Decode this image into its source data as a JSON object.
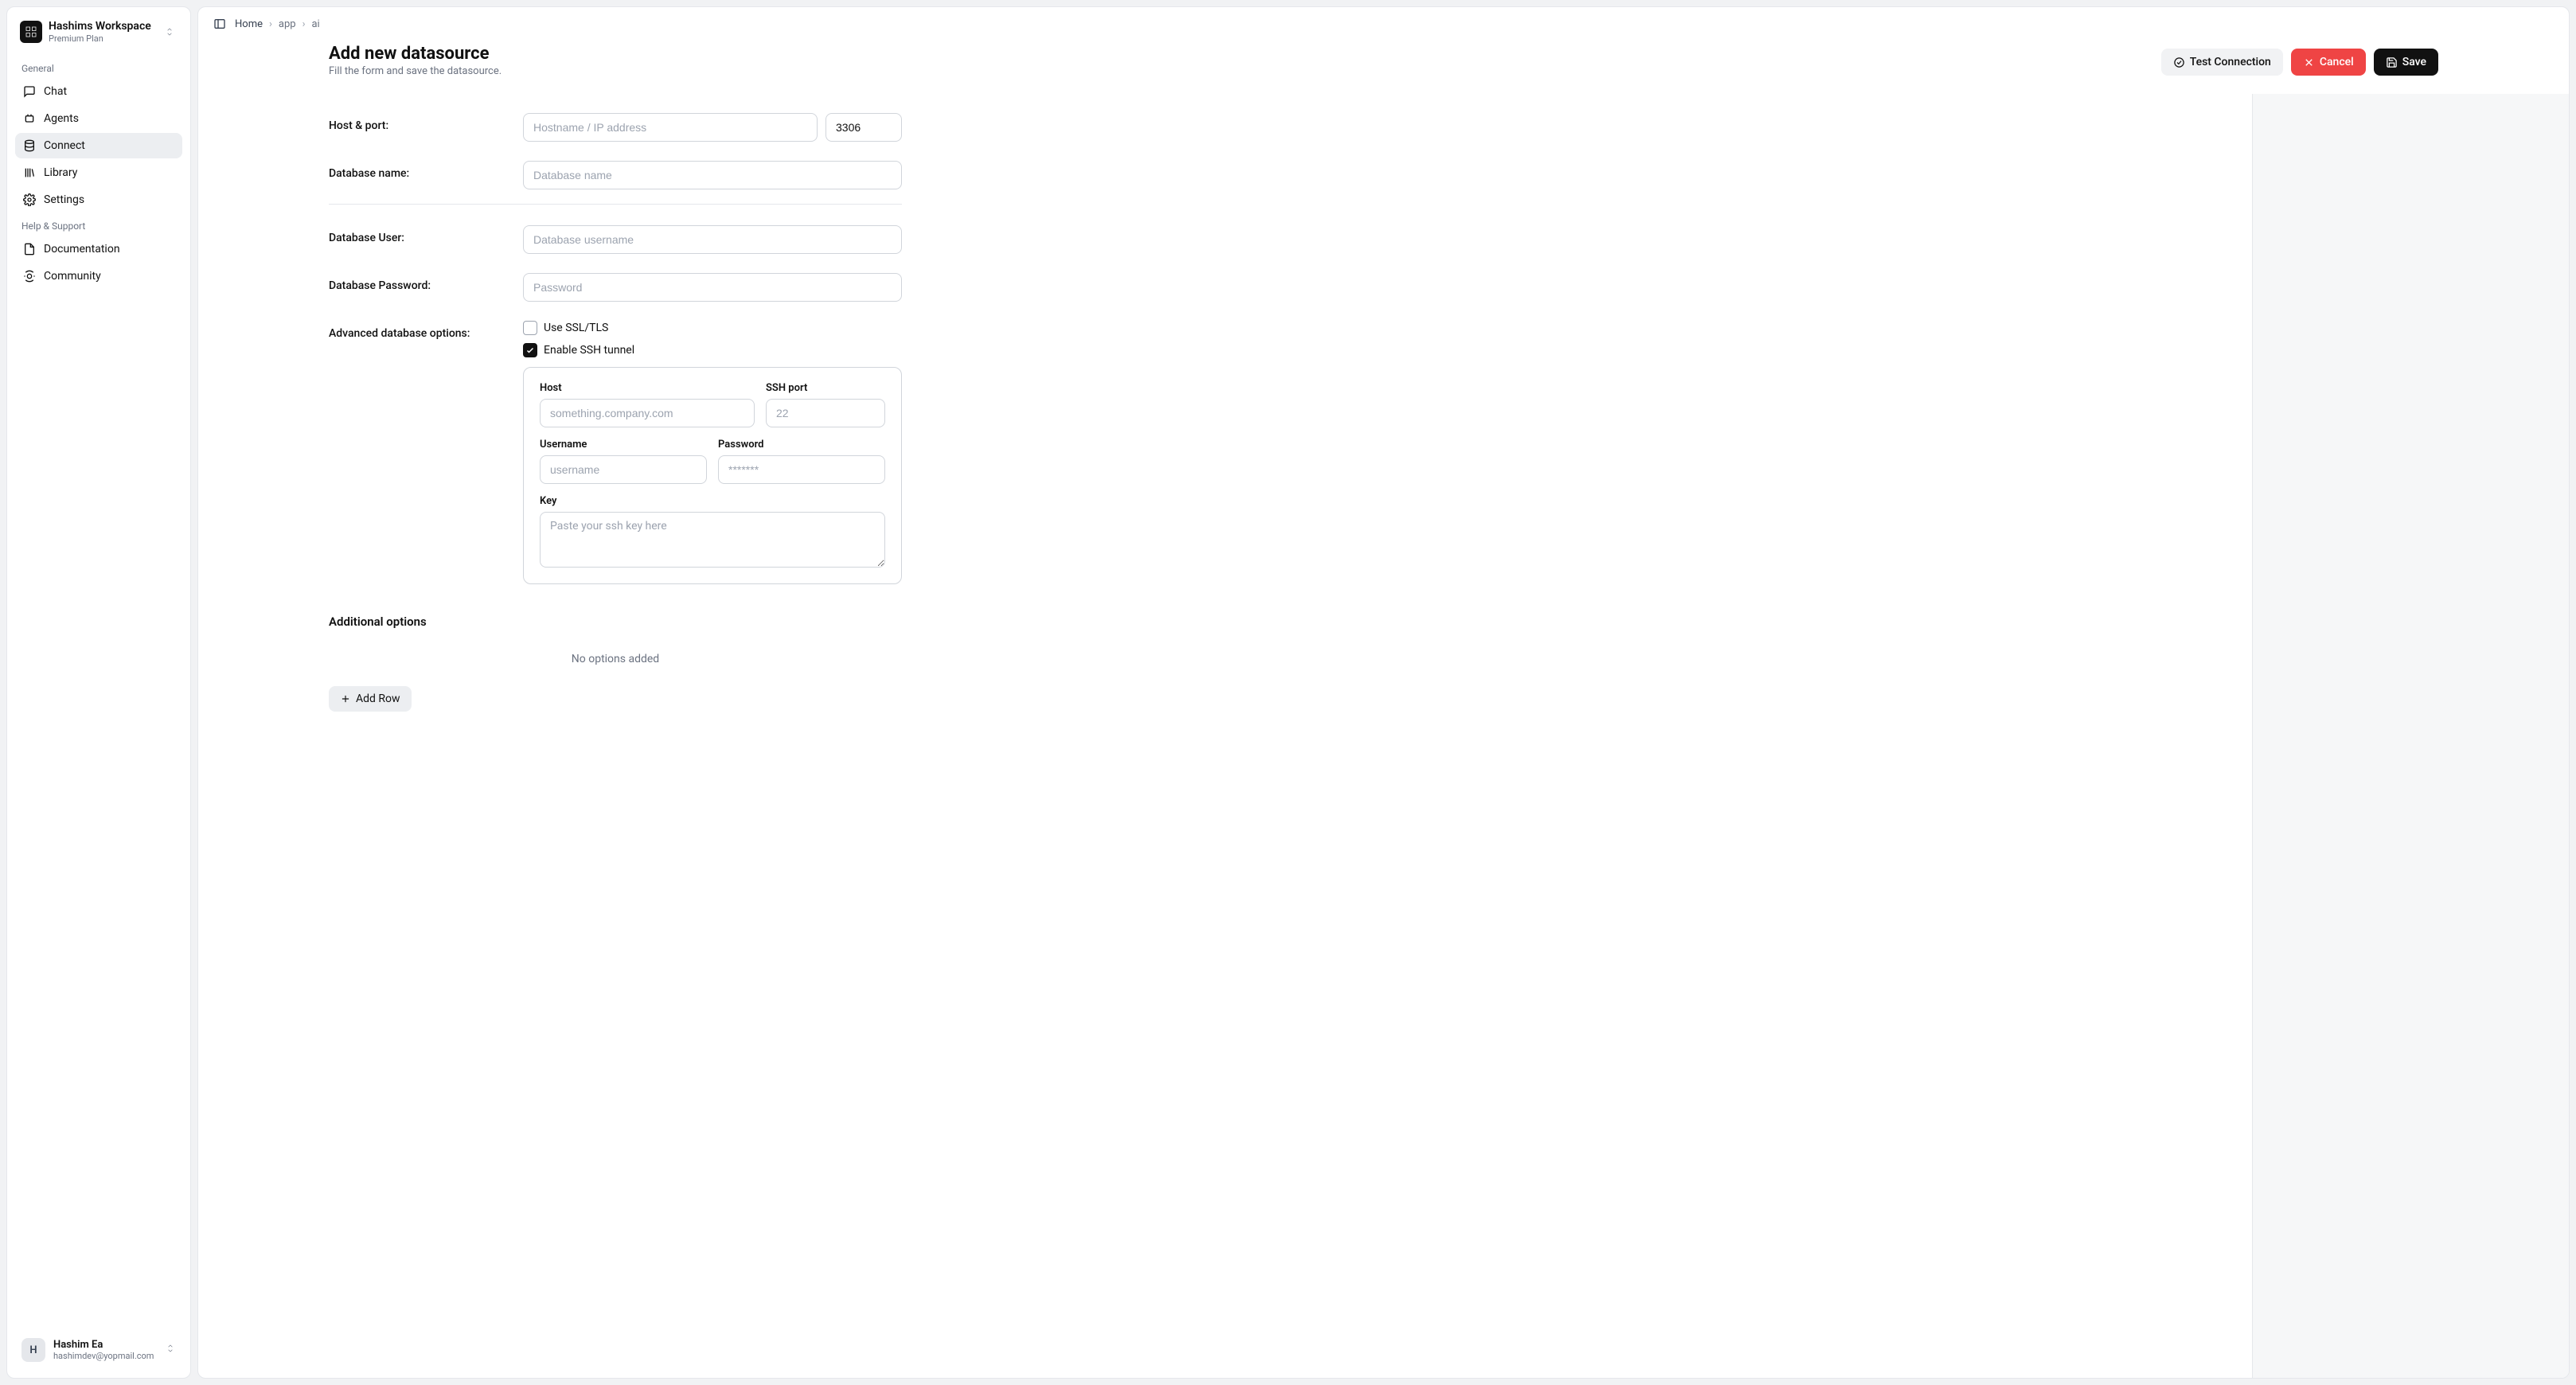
{
  "workspace": {
    "name": "Hashims Workspace",
    "plan": "Premium Plan"
  },
  "sidebar": {
    "general_label": "General",
    "help_label": "Help & Support",
    "items": [
      {
        "id": "chat",
        "label": "Chat"
      },
      {
        "id": "agents",
        "label": "Agents"
      },
      {
        "id": "connect",
        "label": "Connect"
      },
      {
        "id": "library",
        "label": "Library"
      },
      {
        "id": "settings",
        "label": "Settings"
      }
    ],
    "active": "connect",
    "help_items": [
      {
        "id": "documentation",
        "label": "Documentation"
      },
      {
        "id": "community",
        "label": "Community"
      }
    ]
  },
  "user": {
    "initial": "H",
    "name": "Hashim Ea",
    "email": "hashimdev@yopmail.com"
  },
  "breadcrumb": {
    "items": [
      "Home",
      "app",
      "ai"
    ]
  },
  "header": {
    "title": "Add new datasource",
    "subtitle": "Fill the form and save the datasource.",
    "test_label": "Test Connection",
    "cancel_label": "Cancel",
    "save_label": "Save"
  },
  "form": {
    "host_port_label": "Host & port:",
    "host_placeholder": "Hostname / IP address",
    "port_value": "3306",
    "dbname_label": "Database name:",
    "dbname_placeholder": "Database name",
    "dbuser_label": "Database User:",
    "dbuser_placeholder": "Database username",
    "dbpass_label": "Database Password:",
    "dbpass_placeholder": "Password",
    "advanced_label": "Advanced database options:",
    "ssl_label": "Use SSL/TLS",
    "ssl_checked": false,
    "ssh_enable_label": "Enable SSH tunnel",
    "ssh_enable_checked": true,
    "ssh": {
      "host_label": "Host",
      "host_placeholder": "something.company.com",
      "port_label": "SSH port",
      "port_placeholder": "22",
      "username_label": "Username",
      "username_placeholder": "username",
      "password_label": "Password",
      "password_placeholder": "*******",
      "key_label": "Key",
      "key_placeholder": "Paste your ssh key here"
    },
    "additional_label": "Additional options",
    "no_options_msg": "No options added",
    "add_row_label": "Add Row"
  }
}
